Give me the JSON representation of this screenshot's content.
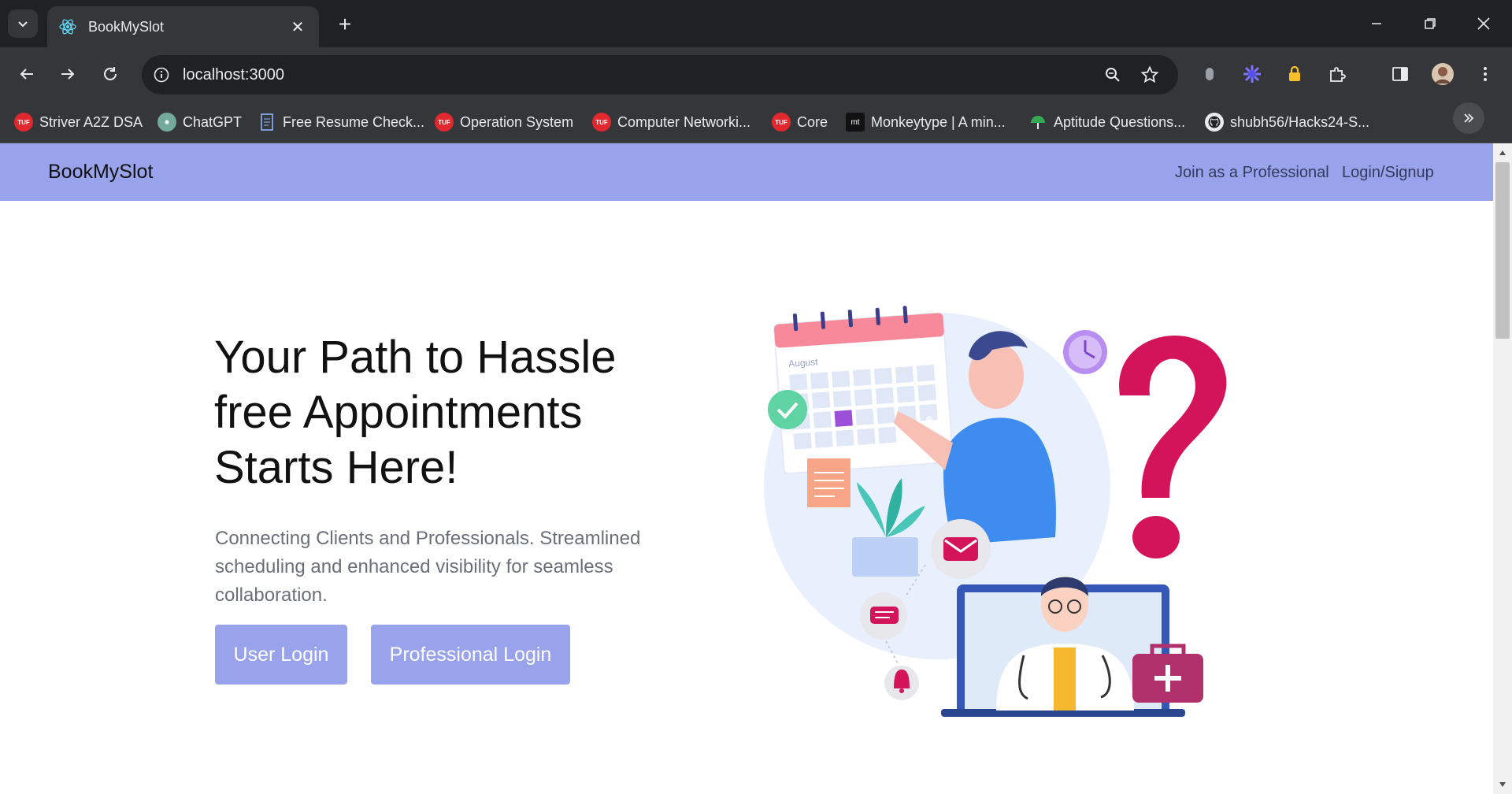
{
  "browser": {
    "tab_title": "BookMySlot",
    "url": "localhost:3000",
    "bookmarks": [
      {
        "label": "Striver A2Z DSA",
        "icon": "tuf-icon"
      },
      {
        "label": "ChatGPT",
        "icon": "chatgpt-icon"
      },
      {
        "label": "Free Resume Check...",
        "icon": "resume-icon"
      },
      {
        "label": "Operation System",
        "icon": "tuf-icon"
      },
      {
        "label": "Computer Networki...",
        "icon": "tuf-icon"
      },
      {
        "label": "Core",
        "icon": "tuf-icon"
      },
      {
        "label": "Monkeytype | A min...",
        "icon": "monkeytype-icon"
      },
      {
        "label": "Aptitude Questions...",
        "icon": "aptitude-icon"
      },
      {
        "label": "shubh56/Hacks24-S...",
        "icon": "github-icon"
      }
    ],
    "tuf_icon_text": "TUF",
    "mt_icon_text": "mt"
  },
  "navbar": {
    "brand": "BookMySlot",
    "join_link": "Join as a Professional",
    "login_link": "Login/Signup"
  },
  "hero": {
    "title": "Your Path to Hassle free Appointments Starts Here!",
    "subtitle": "Connecting Clients and Professionals. Streamlined scheduling and enhanced visibility for seamless collaboration.",
    "user_login": "User Login",
    "professional_login": "Professional Login"
  },
  "illustration": {
    "calendar_month": "August"
  },
  "colors": {
    "navbar_bg": "#99a3eb",
    "button_bg": "#99a3eb",
    "accent_pink": "#d4145a"
  }
}
